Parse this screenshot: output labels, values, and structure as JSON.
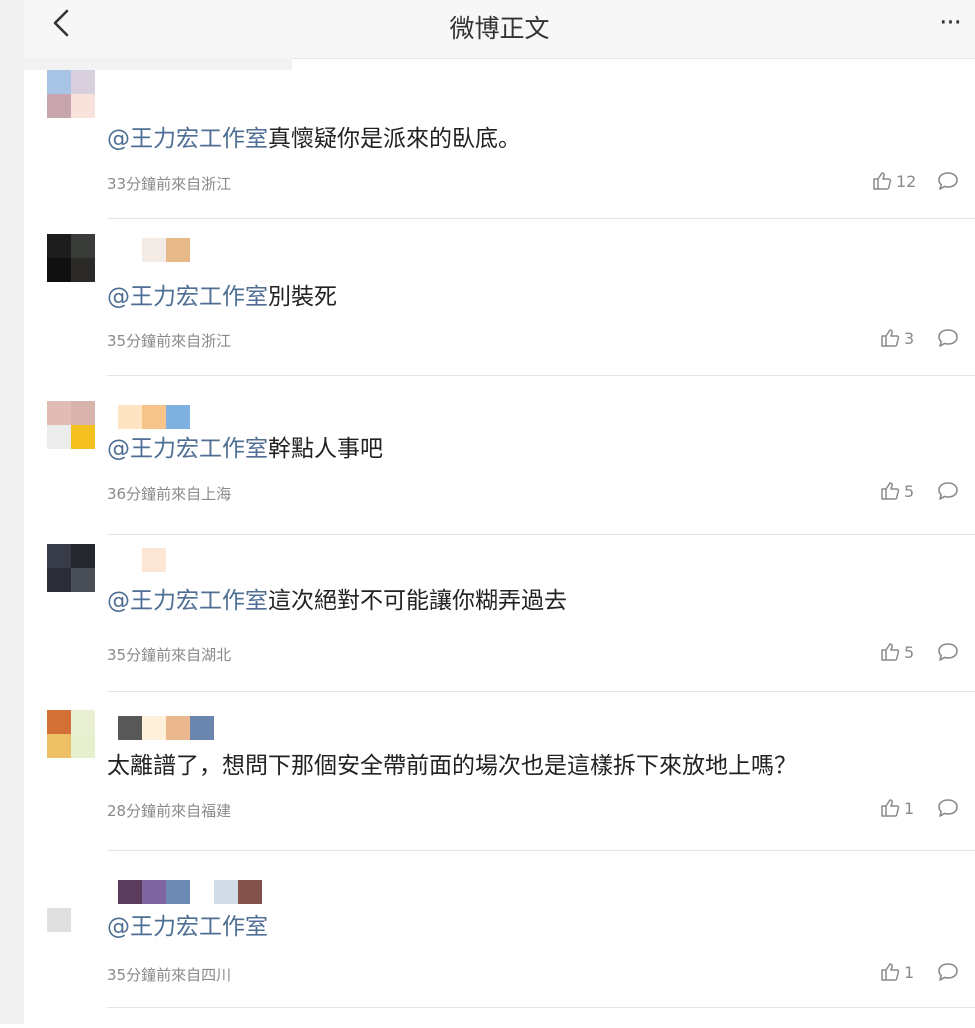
{
  "header": {
    "title": "微博正文",
    "back_icon": "back-chevron-icon",
    "more_label": "···"
  },
  "comments": [
    {
      "avatar_colors": [
        "#a8c4e4",
        "#d8d0dc",
        "#c8a4ac",
        "#f8e2dc"
      ],
      "name_colors": [
        "#ffffff",
        "#ffffff",
        "#ffffff",
        "#ffffff"
      ],
      "mention": "@王力宏工作室",
      "text": "真懷疑你是派來的臥底。",
      "time": "33分鐘前來自浙江",
      "likes": "12"
    },
    {
      "avatar_colors": [
        "#1c1c1c",
        "#3a3c3a",
        "#101010",
        "#2c2a28"
      ],
      "name_colors": [
        "#ffffff",
        "#f2ebe6",
        "#e6b88a"
      ],
      "mention": "@王力宏工作室",
      "text": "別裝死",
      "time": "35分鐘前來自浙江",
      "likes": "3"
    },
    {
      "avatar_colors": [
        "#e0bcb4",
        "#d8b4ac",
        "#ececec",
        "#f4c020"
      ],
      "name_colors": [
        "#ffe4c4",
        "#f6c488",
        "#7eb0e0"
      ],
      "mention": "@王力宏工作室",
      "text": "幹點人事吧",
      "time": "36分鐘前來自上海",
      "likes": "5"
    },
    {
      "avatar_colors": [
        "#383c48",
        "#24272e",
        "#2a2d36",
        "#4a4e56"
      ],
      "name_colors": [
        "#ffffff",
        "#fce6d6"
      ],
      "mention": "@王力宏工作室",
      "text": "這次絕對不可能讓你糊弄過去",
      "time": "35分鐘前來自湖北",
      "likes": "5"
    },
    {
      "avatar_colors": [
        "#d27038",
        "#eaf0d4",
        "#eec066",
        "#e6f0cc"
      ],
      "name_colors": [
        "#585858",
        "#fff0dc",
        "#eab88c",
        "#6a86ae"
      ],
      "mention": "",
      "text": "太離譜了，想問下那個安全帶前面的場次也是這樣拆下來放地上嗎？",
      "time": "28分鐘前來自福建",
      "likes": "1"
    },
    {
      "avatar_colors": [
        "#e0e0e0",
        "#e0e0e0",
        "#e0e0e0",
        "#e0e0e0"
      ],
      "name_colors": [
        "#5a3c5c",
        "#7e64a0",
        "#6c8ab4",
        "#ffffff",
        "#d2dce6",
        "#84524c"
      ],
      "mention": "@王力宏工作室",
      "text": "",
      "time": "35分鐘前來自四川",
      "likes": "1"
    }
  ]
}
